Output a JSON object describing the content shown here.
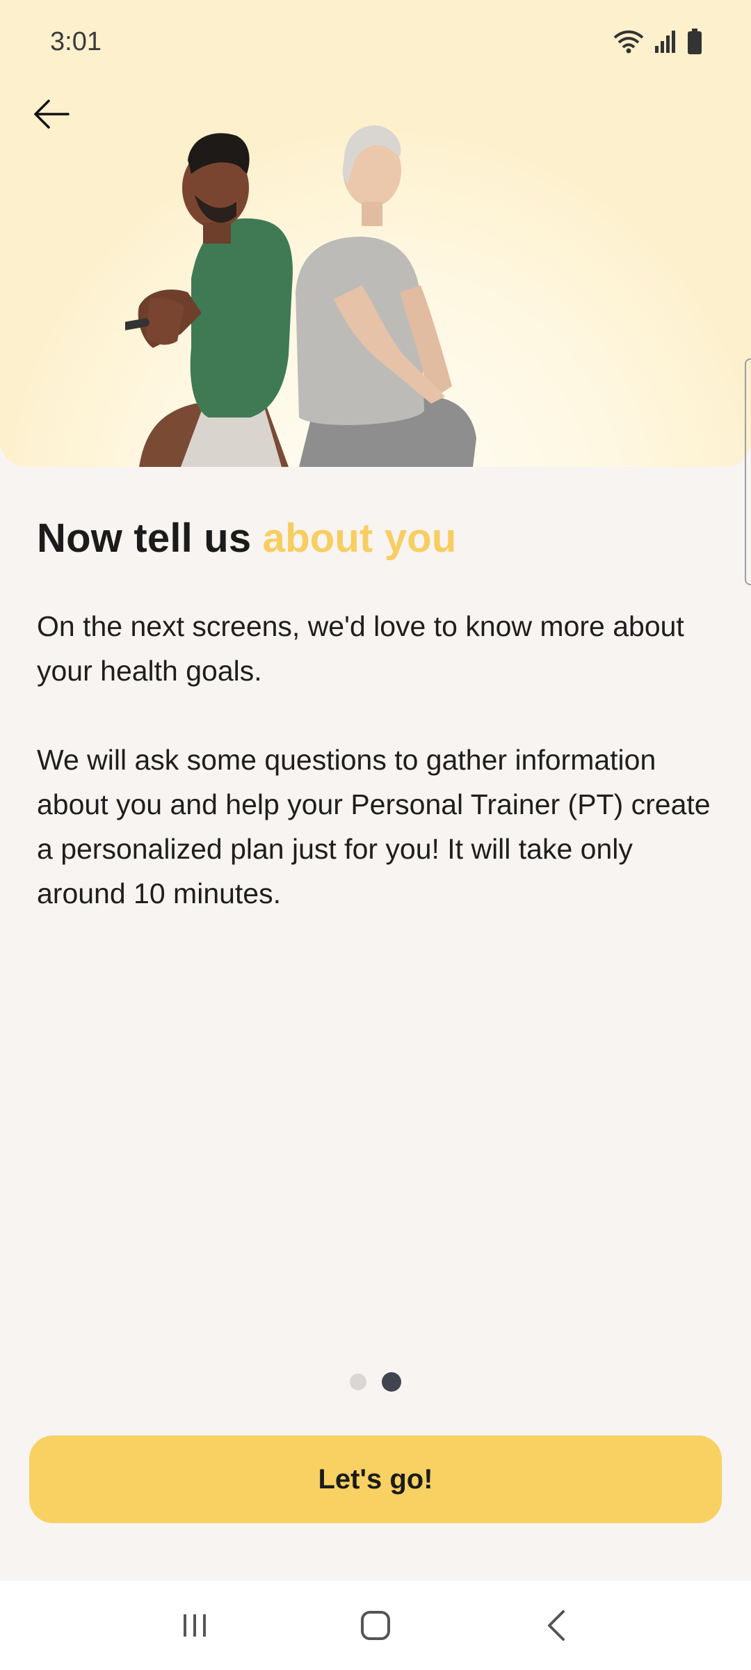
{
  "status_bar": {
    "time": "3:01",
    "icons": [
      "wifi-icon",
      "signal-icon",
      "battery-icon"
    ]
  },
  "header": {
    "back_icon": "arrow-left-icon",
    "hero_image": "people-stretching-illustration"
  },
  "content": {
    "title_main": "Now tell us ",
    "title_accent": "about you",
    "paragraph_1": "On the next screens, we'd love to know more about your health goals.",
    "paragraph_2": "We will ask some questions to gather information about you and help your Personal Trainer (PT) create a personalized plan just for you! It will take only around 10 minutes."
  },
  "pager": {
    "total": 2,
    "active_index": 1
  },
  "cta": {
    "label": "Let's go!"
  },
  "nav_bar": {
    "items": [
      "recent-apps-icon",
      "home-icon",
      "back-icon"
    ]
  },
  "colors": {
    "accent": "#F9D163",
    "title_accent": "#F8CD61",
    "hero_bg": "#FDF0CC",
    "page_bg": "#F7F4F1",
    "dot_active": "#404550",
    "dot_inactive": "#D9D7D4"
  }
}
